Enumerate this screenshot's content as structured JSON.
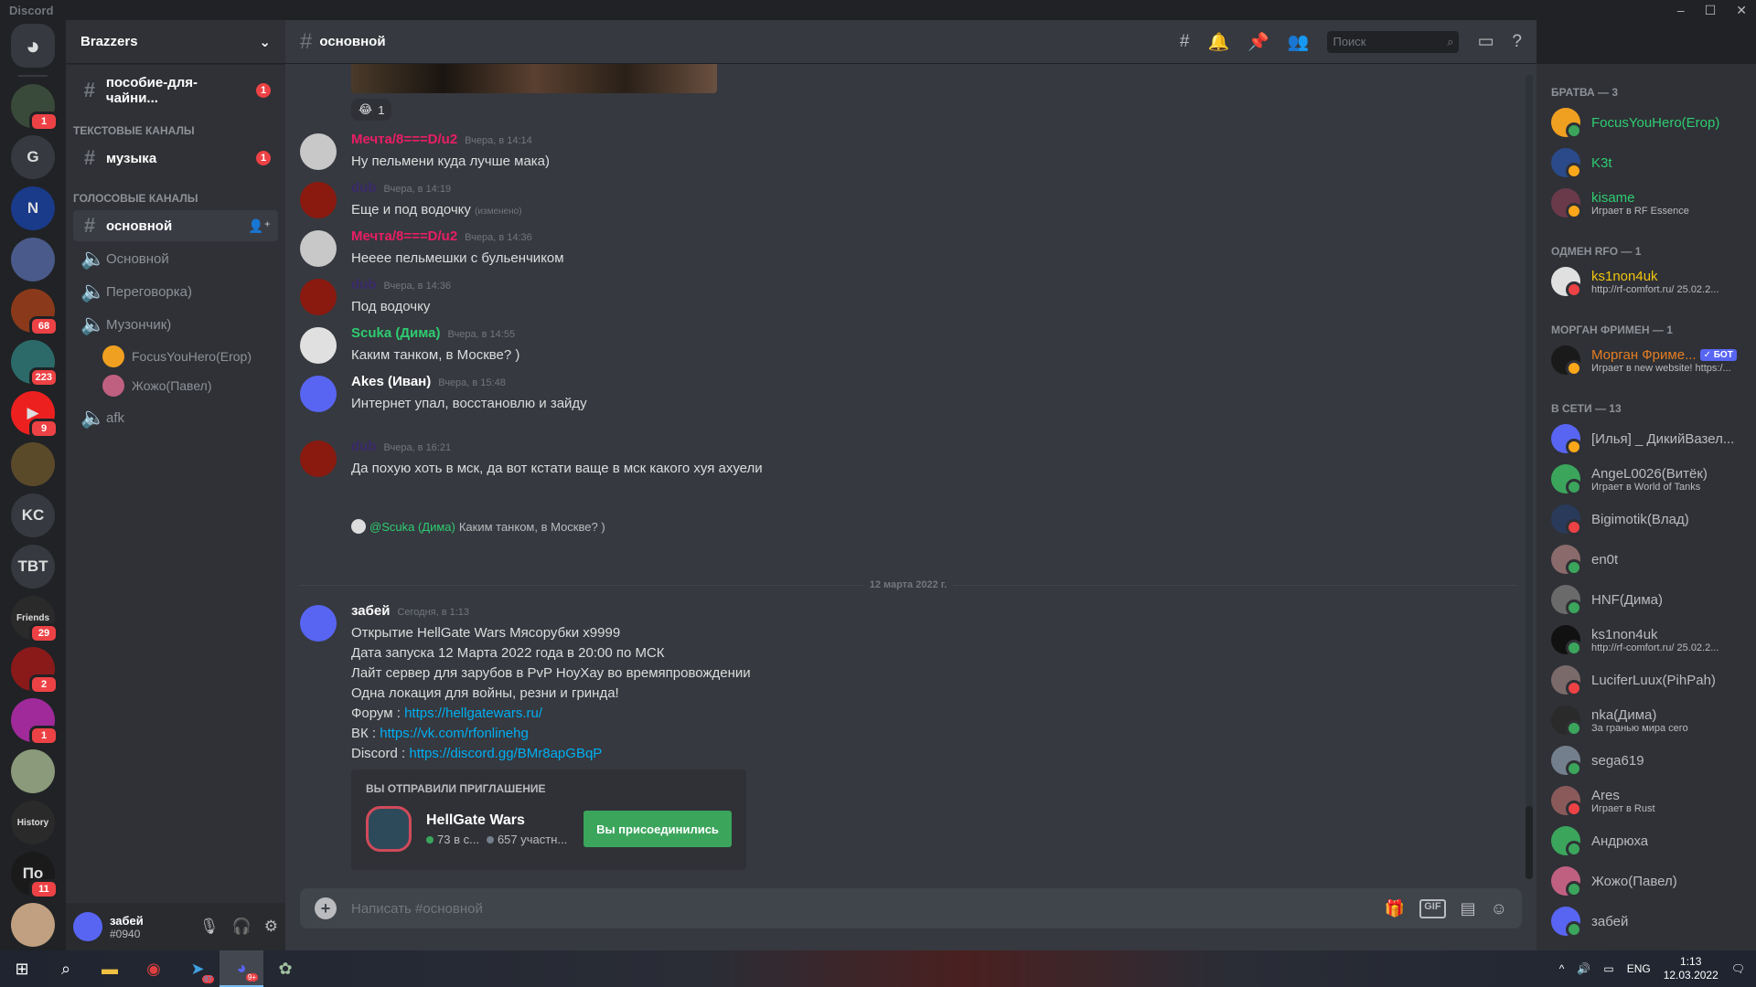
{
  "window": {
    "title": "Discord",
    "controls": [
      "–",
      "☐",
      "✕"
    ]
  },
  "guilds": [
    {
      "name": "home",
      "label": "",
      "color": "#36393f",
      "badge": ""
    },
    {
      "name": "guild-1",
      "label": "",
      "color": "#3a4a3a",
      "badge": "1"
    },
    {
      "name": "guild-g",
      "label": "G",
      "color": "#36393f",
      "badge": ""
    },
    {
      "name": "guild-envyus",
      "label": "N",
      "color": "#1a3a8a",
      "badge": ""
    },
    {
      "name": "guild-4",
      "label": "",
      "color": "#4a5a8a",
      "badge": ""
    },
    {
      "name": "guild-5",
      "label": "",
      "color": "#8a3a1a",
      "badge": "68"
    },
    {
      "name": "guild-hg",
      "label": "",
      "color": "#2c6a6a",
      "badge": "223"
    },
    {
      "name": "guild-youtube",
      "label": "▶",
      "color": "#ed2020",
      "badge": "9"
    },
    {
      "name": "guild-8",
      "label": "",
      "color": "#5a4a2a",
      "badge": ""
    },
    {
      "name": "guild-kc",
      "label": "KC",
      "color": "#36393f",
      "badge": ""
    },
    {
      "name": "guild-tbt",
      "label": "TBT",
      "color": "#36393f",
      "badge": ""
    },
    {
      "name": "guild-friends",
      "label": "Friends",
      "color": "#2a2a2a",
      "badge": "29"
    },
    {
      "name": "guild-12",
      "label": "",
      "color": "#8a1a1a",
      "badge": "2"
    },
    {
      "name": "guild-13",
      "label": "",
      "color": "#a02a9a",
      "badge": "1"
    },
    {
      "name": "guild-14",
      "label": "",
      "color": "#8a9a7a",
      "badge": ""
    },
    {
      "name": "guild-history",
      "label": "History",
      "color": "#2a2a2a",
      "badge": ""
    },
    {
      "name": "guild-16",
      "label": "По",
      "color": "#1a1a1a",
      "badge": "11"
    },
    {
      "name": "guild-17",
      "label": "",
      "color": "#c0a080",
      "badge": ""
    }
  ],
  "server": {
    "name": "Brazzers",
    "top_channel": {
      "name": "пособие-для-чайни...",
      "badge": "1"
    },
    "text_category": "ТЕКСТОВЫЕ КАНАЛЫ",
    "text_channels": [
      {
        "name": "музыка",
        "badge": "1"
      }
    ],
    "voice_category": "ГОЛОСОВЫЕ КАНАЛЫ",
    "active_channel": "основной",
    "voice_channels": [
      "Основной",
      "Переговорка)",
      "Музончик)"
    ],
    "voice_users": [
      {
        "name": "FocusYouHero(Erop)",
        "color": "#f0a020"
      },
      {
        "name": "Жожо(Павел)",
        "color": "#c06080"
      }
    ],
    "afk_channel": "afk"
  },
  "user": {
    "name": "забей",
    "tag": "#0940"
  },
  "chat": {
    "channel": "основной",
    "search_placeholder": "Поиск",
    "reaction": {
      "emoji": "😂",
      "count": "1"
    },
    "messages": [
      {
        "author": "Мечта/8===D/u2",
        "color": "#e91e63",
        "time": "Вчера, в 14:14",
        "lines": [
          "Ну пельмени куда лучше мака)"
        ],
        "avatar": "#c8c8c8"
      },
      {
        "author": "dub",
        "color": "#3a2a6a",
        "time": "Вчера, в 14:19",
        "lines": [
          "Еще и под водочку"
        ],
        "edited": "(изменено)",
        "avatar": "#8a1a10"
      },
      {
        "author": "Мечта/8===D/u2",
        "color": "#e91e63",
        "time": "Вчера, в 14:36",
        "lines": [
          "Нееее пельмешки с бульенчиком"
        ],
        "avatar": "#c8c8c8"
      },
      {
        "author": "dub",
        "color": "#3a2a6a",
        "time": "Вчера, в 14:36",
        "lines": [
          "Под водочку"
        ],
        "avatar": "#8a1a10"
      },
      {
        "author": "Scuka (Дима)",
        "color": "#2ecc71",
        "time": "Вчера, в 14:55",
        "lines": [
          "Каким танком, в Москве? )"
        ],
        "avatar": "#e0e0e0"
      },
      {
        "author": "Akes (Иван)",
        "color": "#ffffff",
        "time": "Вчера, в 15:48",
        "lines": [
          "Интернет упал, восстановлю и зайду"
        ],
        "avatar": "#5865f2"
      },
      {
        "author": "dub",
        "color": "#3a2a6a",
        "time": "Вчера, в 16:21",
        "lines": [
          "Да похую хоть в мск, да вот кстати ваще в мск какого хуя ахуели"
        ],
        "avatar": "#8a1a10"
      }
    ],
    "reply": {
      "mention": "@Scuka (Дима)",
      "text": "Каким танком, в Москве? )"
    },
    "date_divider": "12 марта 2022 г.",
    "last_message": {
      "author": "забей",
      "time": "Сегодня, в 1:13",
      "lines": [
        "Открытие HellGate Wars Мясорубки x9999",
        "Дата запуска 12 Марта 2022 года в 20:00 по МСК",
        "Лайт сервер для зарубов в PvP НоуХау во времяпровождении",
        "Одна локация для войны, резни и гринда!"
      ],
      "forum_label": "Форум : ",
      "forum_link": "https://hellgatewars.ru/",
      "vk_label": "ВК : ",
      "vk_link": "https://vk.com/rfonlinehg",
      "discord_label": "Discord : ",
      "discord_link": "https://discord.gg/BMr8apGBqP"
    },
    "invite": {
      "label": "ВЫ ОТПРАВИЛИ ПРИГЛАШЕНИЕ",
      "server": "HellGate Wars",
      "online": "73 в с...",
      "members": "657 участн...",
      "button": "Вы присоединились"
    },
    "composer_placeholder": "Написать #основной"
  },
  "members": [
    {
      "category": "БРАТВА — 3",
      "list": [
        {
          "name": "FocusYouHero(Erop)",
          "color": "#2ecc71",
          "status": "",
          "avatar": "#f0a020",
          "state": "#3ba55c"
        },
        {
          "name": "K3t",
          "color": "#2ecc71",
          "status": "",
          "avatar": "#2a4a8a",
          "state": "#faa81a"
        },
        {
          "name": "kisame",
          "color": "#2ecc71",
          "status": "Играет в RF Essence",
          "avatar": "#6a3a4a",
          "state": "#faa81a"
        }
      ]
    },
    {
      "category": "ОДМЕН RFO — 1",
      "list": [
        {
          "name": "ks1non4uk",
          "color": "#f1c40f",
          "status": "http://rf-comfort.ru/ 25.02.2...",
          "avatar": "#e0e0e0",
          "state": "#ed4245"
        }
      ]
    },
    {
      "category": "МОРГАН ФРИМЕН — 1",
      "list": [
        {
          "name": "Морган Фриме...",
          "color": "#e67e22",
          "status": "Играет в new website! https:/...",
          "avatar": "#1a1a1a",
          "state": "#faa81a",
          "bot": "✓ БОТ"
        }
      ]
    },
    {
      "category": "В СЕТИ — 13",
      "list": [
        {
          "name": "[Илья] _ ДикийВазел...",
          "color": "#b9bbbe",
          "status": "",
          "avatar": "#5865f2",
          "state": "#faa81a"
        },
        {
          "name": "AngeL0026(Витёк)",
          "color": "#b9bbbe",
          "status": "Играет в World of Tanks",
          "avatar": "#3ba55c",
          "state": "#3ba55c"
        },
        {
          "name": "Bigimotik(Влад)",
          "color": "#b9bbbe",
          "status": "",
          "avatar": "#2a3a5a",
          "state": "#ed4245"
        },
        {
          "name": "en0t",
          "color": "#b9bbbe",
          "status": "",
          "avatar": "#8a6a6a",
          "state": "#3ba55c"
        },
        {
          "name": "HNF(Дима)",
          "color": "#b9bbbe",
          "status": "",
          "avatar": "#6a6a6a",
          "state": "#3ba55c"
        },
        {
          "name": "ks1non4uk",
          "color": "#b9bbbe",
          "status": "http://rf-comfort.ru/ 25.02.2...",
          "avatar": "#111111",
          "state": "#3ba55c"
        },
        {
          "name": "LuciferLuux(PihPah)",
          "color": "#b9bbbe",
          "status": "",
          "avatar": "#7a6a6a",
          "state": "#ed4245"
        },
        {
          "name": "nka(Дима)",
          "color": "#b9bbbe",
          "status": "За гранью мира сего",
          "avatar": "#2a2a2a",
          "state": "#3ba55c"
        },
        {
          "name": "sega619",
          "color": "#b9bbbe",
          "status": "",
          "avatar": "#747f8d",
          "state": "#3ba55c"
        },
        {
          "name": "Ares",
          "color": "#b9bbbe",
          "status": "Играет в Rust",
          "avatar": "#8a5a5a",
          "state": "#ed4245"
        },
        {
          "name": "Андрюха",
          "color": "#b9bbbe",
          "status": "",
          "avatar": "#3ba55c",
          "state": "#3ba55c"
        },
        {
          "name": "Жожо(Павел)",
          "color": "#b9bbbe",
          "status": "",
          "avatar": "#c06080",
          "state": "#3ba55c"
        },
        {
          "name": "забей",
          "color": "#b9bbbe",
          "status": "",
          "avatar": "#5865f2",
          "state": "#3ba55c"
        }
      ]
    }
  ],
  "taskbar": {
    "lang": "ENG",
    "time": "1:13",
    "date": "12.03.2022",
    "telegram_badge": "87",
    "discord_badge": "9+"
  }
}
